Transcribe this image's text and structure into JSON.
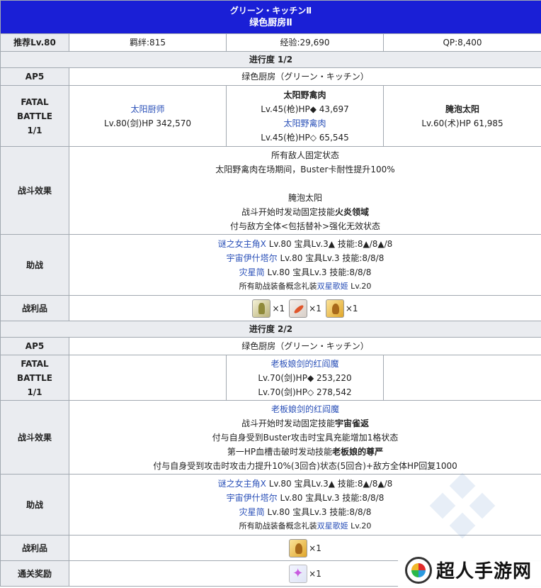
{
  "header": {
    "title": "グリーン・キッチンⅡ",
    "subtitle": "绿色厨房Ⅱ"
  },
  "info": {
    "level": "推荐Lv.80",
    "bond": "羁绊:815",
    "exp": "经验:29,690",
    "qp": "QP:8,400"
  },
  "labels": {
    "ap": "AP5",
    "fatal_1": "FATAL",
    "fatal_2": "BATTLE",
    "fatal_3": "1/1",
    "effects": "战斗效果",
    "support": "助战",
    "drops": "战利品",
    "reward": "通关奖励"
  },
  "stage1": {
    "title": "进行度 1/2",
    "location": "绿色厨房（グリーン・キッチン）",
    "enemy_a_name": "太阳厨师",
    "enemy_a_stat": "Lv.80(剑)HP 342,570",
    "enemy_b_name": "太阳野禽肉",
    "enemy_b_stat": "Lv.45(枪)HP◆ 43,697",
    "enemy_c_name": "太阳野禽肉",
    "enemy_c_stat": "Lv.45(枪)HP◇ 65,545",
    "enemy_d_name": "腌泡太阳",
    "enemy_d_stat": "Lv.60(术)HP 61,985",
    "effect_1": "所有敌人固定状态",
    "effect_2": "太阳野禽肉在场期间，Buster卡耐性提升100%",
    "effect_3": "腌泡太阳",
    "effect_4_pre": "战斗开始时发动固定技能",
    "effect_4_bold": "火炎领域",
    "effect_5": "付与敌方全体<包括替补>强化无效状态",
    "support_1_name": "谜之女主角X",
    "support_1_info": " Lv.80 宝具Lv.3▲ 技能:8▲/8▲/8",
    "support_2_name": "宇宙伊什塔尔",
    "support_2_info": " Lv.80 宝具Lv.3 技能:8/8/8",
    "support_3_name": "灾星简",
    "support_3_info": " Lv.80 宝具Lv.3 技能:8/8/8",
    "support_note_pre": "所有助战装备概念礼装",
    "support_note_link": "双星歌姬",
    "support_note_post": " Lv.20",
    "drop_1": "×1",
    "drop_2": "×1",
    "drop_3": "×1"
  },
  "stage2": {
    "title": "进行度 2/2",
    "location": "绿色厨房（グリーン・キッチン）",
    "enemy_name": "老板娘剑的红阎魔",
    "enemy_stat_1": "Lv.70(剑)HP◆ 253,220",
    "enemy_stat_2": "Lv.70(剑)HP◇ 278,542",
    "effect_1": "老板娘剑的红阎魔",
    "effect_2_pre": "战斗开始时发动固定技能",
    "effect_2_bold": "宇宙雀返",
    "effect_3": "付与自身受到Buster攻击时宝具充能增加1格状态",
    "effect_4_pre": "第一HP血槽击破时发动技能",
    "effect_4_bold": "老板娘的尊严",
    "effect_5": "付与自身受到攻击时攻击力提升10%(3回合)状态(5回合)+敌方全体HP回复1000",
    "support_1_name": "谜之女主角X",
    "support_1_info": " Lv.80 宝具Lv.3▲ 技能:8▲/8▲/8",
    "support_2_name": "宇宙伊什塔尔",
    "support_2_info": " Lv.80 宝具Lv.3 技能:8/8/8",
    "support_3_name": "灾星简",
    "support_3_info": " Lv.80 宝具Lv.3 技能:8/8/8",
    "support_note_pre": "所有助战装备概念礼装",
    "support_note_link": "双星歌姬",
    "support_note_post": " Lv.20",
    "drop_1": "×1",
    "reward_1": "×1"
  },
  "watermark": {
    "text": "超人手游网"
  },
  "icons": {
    "drop_a": "golden-gem-icon",
    "drop_b": "red-feather-icon",
    "drop_c": "gold-statue-icon",
    "reward": "saint-quartz-star-icon"
  },
  "colors": {
    "header_bg": "#1a1fd6",
    "label_bg": "#eaecf0",
    "link": "#2a50b8",
    "border": "#a2a9b1"
  }
}
